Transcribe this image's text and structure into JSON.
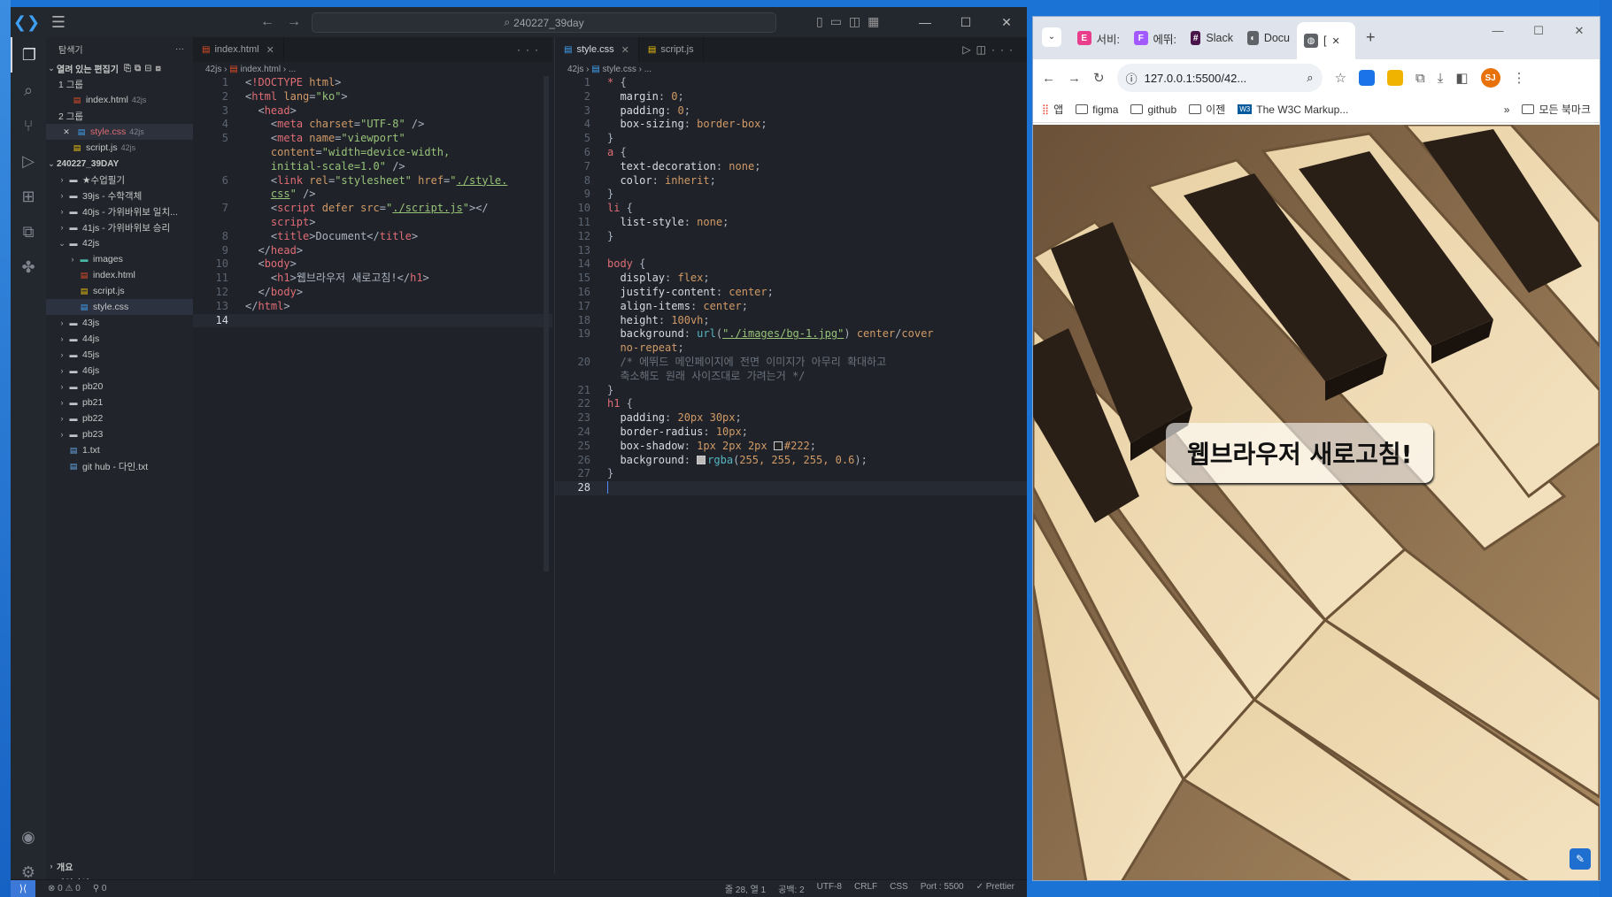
{
  "vscode": {
    "command_center": "240227_39day",
    "window_controls": [
      "—",
      "☐",
      "✕"
    ],
    "explorer": {
      "title": "탐색기",
      "open_editors_label": "열려 있는 편집기",
      "group1_label": "1 그룹",
      "group2_label": "2 그룹",
      "group1_files": [
        {
          "name": "index.html",
          "dir": "42js"
        }
      ],
      "group2_files": [
        {
          "name": "style.css",
          "dir": "42js"
        },
        {
          "name": "script.js",
          "dir": "42js"
        }
      ],
      "workspace_label": "240227_39DAY",
      "tree": [
        {
          "name": "★수업필기",
          "type": "folder",
          "depth": 1
        },
        {
          "name": "39js - 수학객체",
          "type": "folder",
          "depth": 1
        },
        {
          "name": "40js - 가위바위보 일치...",
          "type": "folder",
          "depth": 1
        },
        {
          "name": "41js - 가위바위보 승리",
          "type": "folder",
          "depth": 1
        },
        {
          "name": "42js",
          "type": "folder-open",
          "depth": 1
        },
        {
          "name": "images",
          "type": "img-folder",
          "depth": 2
        },
        {
          "name": "index.html",
          "type": "html",
          "depth": 2
        },
        {
          "name": "script.js",
          "type": "js",
          "depth": 2
        },
        {
          "name": "style.css",
          "type": "css",
          "depth": 2
        },
        {
          "name": "43js",
          "type": "folder",
          "depth": 1
        },
        {
          "name": "44js",
          "type": "folder",
          "depth": 1
        },
        {
          "name": "45js",
          "type": "folder",
          "depth": 1
        },
        {
          "name": "46js",
          "type": "folder",
          "depth": 1
        },
        {
          "name": "pb20",
          "type": "folder",
          "depth": 1
        },
        {
          "name": "pb21",
          "type": "folder",
          "depth": 1
        },
        {
          "name": "pb22",
          "type": "folder",
          "depth": 1
        },
        {
          "name": "pb23",
          "type": "folder",
          "depth": 1
        },
        {
          "name": "1.txt",
          "type": "txt",
          "depth": 1
        },
        {
          "name": "git hub - 다인.txt",
          "type": "txt",
          "depth": 1
        }
      ],
      "outline_label": "개요",
      "timeline_label": "타임라인"
    },
    "editor1": {
      "tab": "index.html",
      "breadcrumb": [
        "42js",
        "index.html",
        "..."
      ],
      "current_line": "14"
    },
    "editor2": {
      "tabs": [
        "style.css",
        "script.js"
      ],
      "breadcrumb": [
        "42js",
        "style.css",
        "..."
      ],
      "current_line": "28"
    },
    "status": {
      "problems": "⊗ 0 ⚠ 0",
      "ports": "⚲ 0",
      "position": "줄 28, 열 1",
      "spaces": "공백: 2",
      "encoding": "UTF-8",
      "eol": "CRLF",
      "language": "CSS",
      "port": "Port : 5500",
      "formatter": "✓ Prettier"
    }
  },
  "chrome": {
    "tabs": [
      {
        "title": "서비:",
        "color": "#e83e8c",
        "glyph": "E"
      },
      {
        "title": "에뛰:",
        "color": "#a259ff",
        "glyph": "F"
      },
      {
        "title": "Slack",
        "color": "#4a154b",
        "glyph": "#"
      },
      {
        "title": "Docu",
        "color": "#5f6368",
        "glyph": "◐"
      },
      {
        "title": "[",
        "color": "#5f6368",
        "glyph": "◍"
      }
    ],
    "address": "127.0.0.1:5500/42...",
    "avatar_initials": "SJ",
    "bookmarks": [
      "앱",
      "figma",
      "github",
      "이젠",
      "The W3C Markup...",
      "모든 북마크"
    ],
    "page_heading": "웹브라우저 새로고침!"
  }
}
